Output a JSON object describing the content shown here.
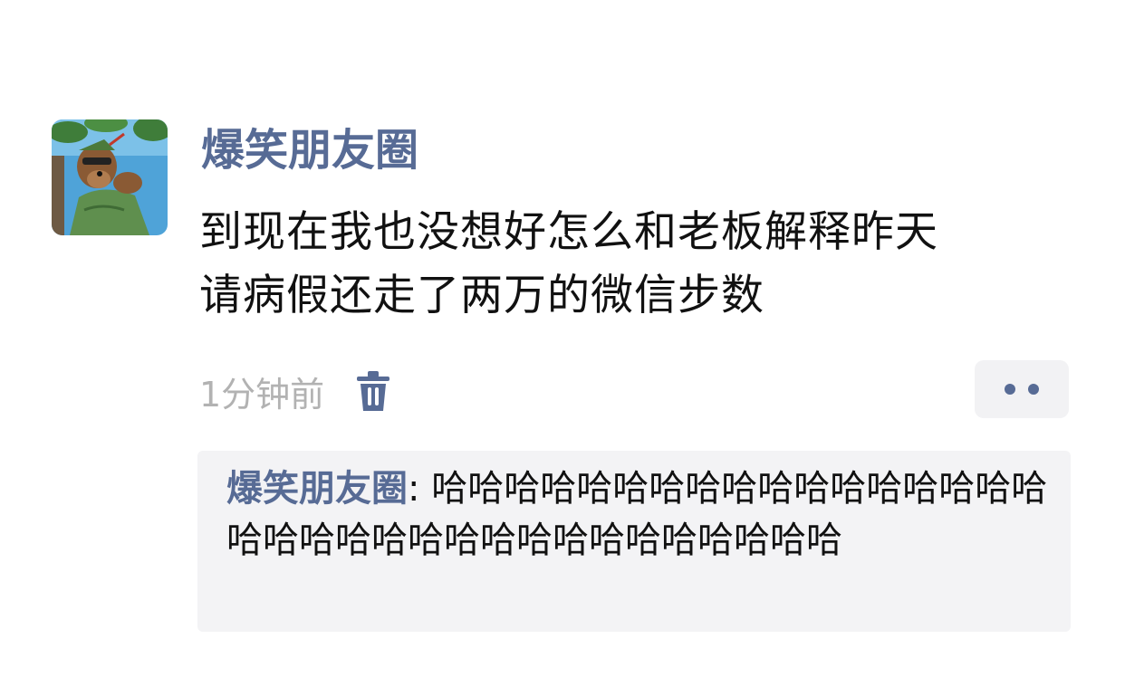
{
  "post": {
    "author": "爆笑朋友圈",
    "avatar_icon": "cartoon-bear-avatar",
    "text_lines": [
      "到现在我也没想好怎么和老板解释昨天",
      "请病假还走了两万的微信步数"
    ],
    "time": "1分钟前",
    "delete_icon": "trash-icon",
    "more_icon": "more-dots-icon"
  },
  "comments": [
    {
      "author": "爆笑朋友圈",
      "separator": ": ",
      "text": "哈哈哈哈哈哈哈哈哈哈哈哈哈哈哈哈哈哈哈哈哈哈哈哈哈哈哈哈哈哈哈哈哈哈"
    }
  ],
  "colors": {
    "link": "#576b95",
    "text": "#111111",
    "meta": "#b2b2b2",
    "comment_bg": "#f3f3f5",
    "more_bg": "#f2f2f4"
  }
}
